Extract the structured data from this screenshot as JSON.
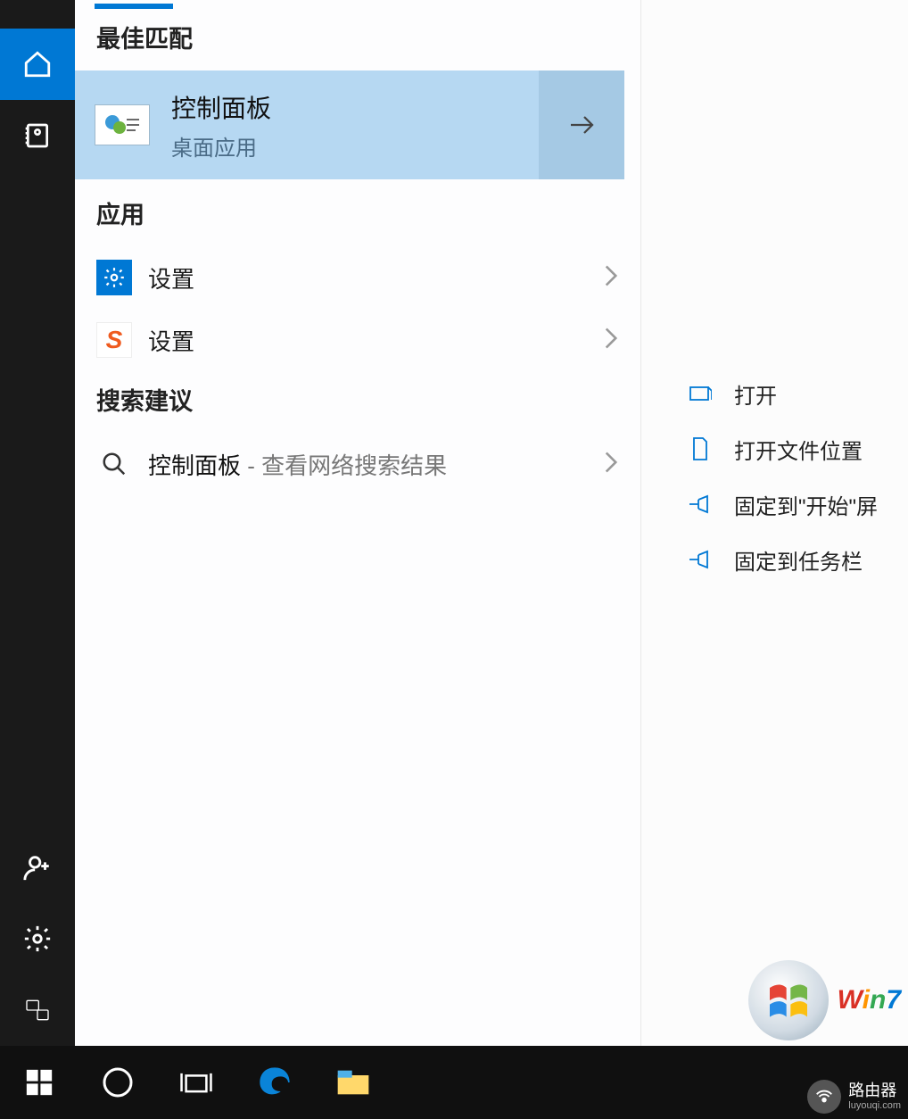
{
  "sections": {
    "best_match": "最佳匹配",
    "apps": "应用",
    "suggestions": "搜索建议"
  },
  "bestMatch": {
    "title": "控制面板",
    "subtitle": "桌面应用"
  },
  "apps": [
    {
      "icon": "settings-blue",
      "label": "设置"
    },
    {
      "icon": "s-orange",
      "label": "设置"
    }
  ],
  "suggestion": {
    "primary": "控制面板",
    "secondary": " - 查看网络搜索结果"
  },
  "search": {
    "value": "控制面板"
  },
  "actions": [
    {
      "icon": "open",
      "label": "打开"
    },
    {
      "icon": "folder",
      "label": "打开文件位置"
    },
    {
      "icon": "pin",
      "label": "固定到\"开始\"屏"
    },
    {
      "icon": "pin",
      "label": "固定到任务栏"
    }
  ],
  "watermark": {
    "brand": "路由器",
    "domain": "luyouqi.com"
  }
}
